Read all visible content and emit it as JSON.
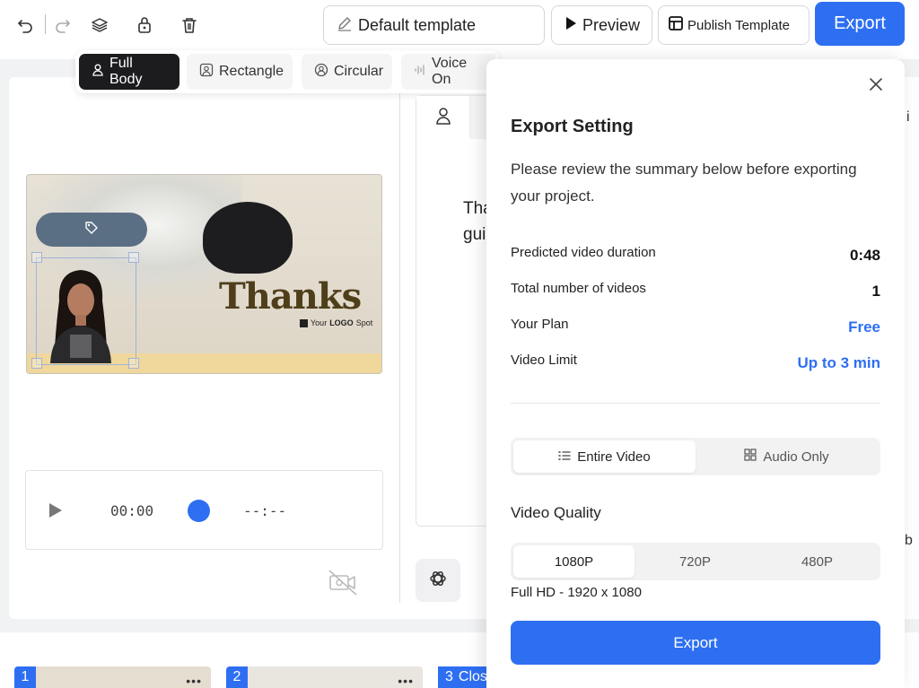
{
  "toolbar": {
    "template_name": "Default template",
    "preview_label": "Preview",
    "publish_label": "Publish Template",
    "export_label": "Export"
  },
  "shapes": {
    "full_body": "Full Body",
    "rectangle": "Rectangle",
    "circular": "Circular",
    "voice_only": "Voice On"
  },
  "slide": {
    "headline": "Thanks",
    "logo_text_prefix": "Your",
    "logo_text_bold": "LOGO",
    "logo_text_suffix": "Spot"
  },
  "player": {
    "current_time": "00:00",
    "total_time": "--:--"
  },
  "script_panel": {
    "line1": "Tha",
    "line2": "gui"
  },
  "edge": {
    "top_right": "i",
    "mid_right": "b"
  },
  "scenes": [
    {
      "number": "1"
    },
    {
      "number": "2"
    },
    {
      "number": "3",
      "title": "Clos"
    }
  ],
  "export_dialog": {
    "title": "Export Setting",
    "description": "Please review the summary below before exporting your project.",
    "rows": [
      {
        "label": "Predicted video duration",
        "value": "0:48"
      },
      {
        "label": "Total number of videos",
        "value": "1"
      },
      {
        "label": "Your Plan",
        "value": "Free"
      },
      {
        "label": "Video Limit",
        "value": "Up to 3 min"
      }
    ],
    "mode_options": [
      "Entire Video",
      "Audio Only"
    ],
    "selected_mode": "Entire Video",
    "video_quality_label": "Video Quality",
    "quality_options": [
      "1080P",
      "720P",
      "480P"
    ],
    "selected_quality": "1080P",
    "quality_description": "Full HD - 1920 x 1080",
    "export_button": "Export"
  },
  "colors": {
    "accent": "#2e6ff2",
    "dark_chip": "#1c1c1e"
  }
}
